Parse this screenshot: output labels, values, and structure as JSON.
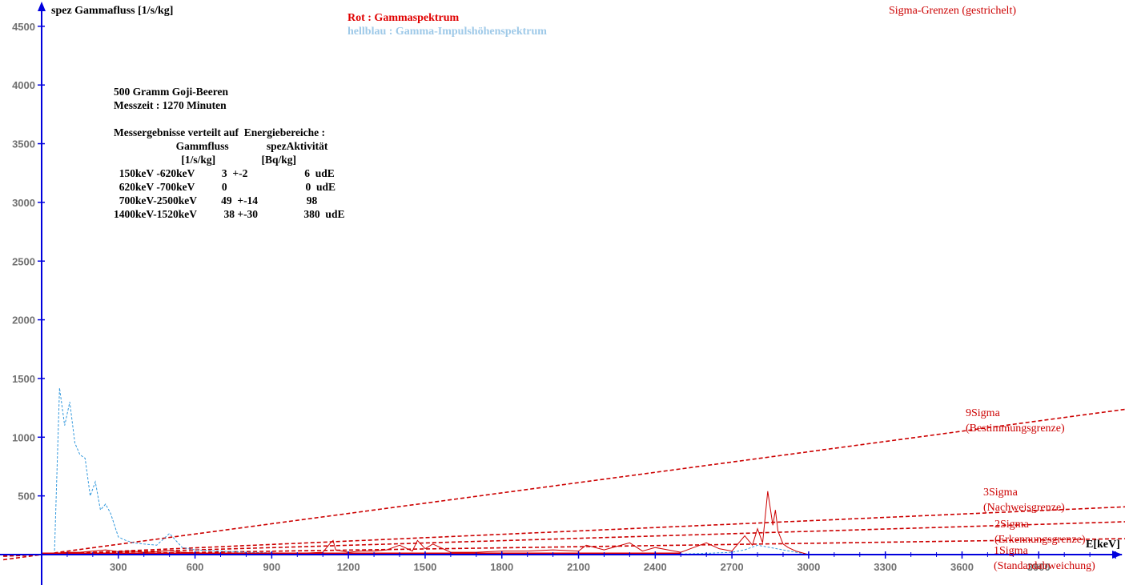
{
  "chart_data": {
    "type": "line",
    "ylabel": "spez Gammafluss [1/s/kg]",
    "xlabel": "E[keV]",
    "xlim": [
      -150,
      3900
    ],
    "ylim": [
      -40,
      4700
    ],
    "x_ticks": [
      300,
      600,
      900,
      1200,
      1500,
      1800,
      2100,
      2400,
      2700,
      3000,
      3300,
      3600,
      3900
    ],
    "y_ticks": [
      500,
      1000,
      1500,
      2000,
      2500,
      3000,
      3500,
      4000,
      4500
    ],
    "grid": false,
    "legend": {
      "red_label": "Rot   : Gammaspektrum",
      "blue_label": "hellblau : Gamma-Impulshöhenspektrum",
      "sigma_label": "Sigma-Grenzen (gestrichelt)"
    },
    "colors": {
      "red": "#cc0000",
      "blue": "#3399dd",
      "axis": "#0000dd"
    },
    "info_lines": [
      "500 Gramm Goji-Beeren",
      "Messzeit : 1270 Minuten",
      "",
      "Messergebnisse verteilt auf  Energiebereiche :",
      "                       Gammfluss              spezAktivität",
      "                         [1/s/kg]                 [Bq/kg]",
      "  150keV -620keV          3  +-2                     6  udE",
      "  620keV -700keV          0                             0  udE",
      "  700keV-2500keV         49  +-14                  98",
      "1400keV-1520keV          38 +-30                 380  udE"
    ],
    "sigma_lines": [
      {
        "label1": "9Sigma",
        "label2": "(Bestimmungsgrenze)",
        "slope": 0.292
      },
      {
        "label1": "3Sigma",
        "label2": "(Nachweisgrenze)",
        "slope": 0.096
      },
      {
        "label1": "2Sigma",
        "label2": "(Erkennungsgrenze)",
        "slope": 0.066
      },
      {
        "label1": "1Sigma",
        "label2": "(Standardabweichung)",
        "slope": 0.032
      }
    ],
    "series": [
      {
        "x": [
          50,
          70,
          90,
          110,
          130,
          150,
          170,
          190,
          210,
          230,
          250,
          270,
          300,
          330,
          360,
          400,
          450,
          500,
          550,
          600,
          700,
          800,
          900,
          1000,
          1100,
          1200,
          1300,
          1400,
          1500,
          1600,
          1700,
          1800,
          1900,
          2000,
          2100,
          2200,
          2300,
          2400,
          2500,
          2600,
          2700,
          2750,
          2800,
          2850,
          2900,
          2950,
          3000
        ],
        "values": [
          0,
          1420,
          1100,
          1300,
          950,
          850,
          820,
          500,
          620,
          380,
          430,
          350,
          150,
          120,
          100,
          90,
          80,
          180,
          60,
          40,
          30,
          20,
          15,
          10,
          10,
          10,
          8,
          8,
          8,
          6,
          6,
          5,
          5,
          5,
          5,
          5,
          5,
          5,
          5,
          10,
          20,
          40,
          80,
          60,
          40,
          20,
          0
        ]
      },
      {
        "x": [
          0,
          50,
          100,
          150,
          200,
          250,
          300,
          350,
          400,
          450,
          500,
          550,
          600,
          700,
          800,
          900,
          1000,
          1100,
          1130,
          1140,
          1150,
          1200,
          1250,
          1300,
          1350,
          1400,
          1450,
          1470,
          1500,
          1530,
          1600,
          1700,
          1800,
          1900,
          2000,
          2100,
          2130,
          2200,
          2300,
          2350,
          2400,
          2450,
          2500,
          2550,
          2600,
          2650,
          2700,
          2750,
          2780,
          2800,
          2820,
          2840,
          2860,
          2870,
          2880,
          2900,
          2920,
          2950,
          3000
        ],
        "values": [
          0,
          10,
          20,
          20,
          30,
          40,
          25,
          30,
          20,
          25,
          35,
          20,
          15,
          10,
          10,
          10,
          10,
          20,
          100,
          120,
          40,
          20,
          30,
          30,
          40,
          80,
          30,
          120,
          50,
          90,
          20,
          20,
          30,
          30,
          40,
          30,
          80,
          40,
          100,
          30,
          60,
          40,
          20,
          60,
          100,
          50,
          30,
          160,
          80,
          220,
          100,
          540,
          250,
          380,
          200,
          90,
          60,
          30,
          0
        ]
      }
    ]
  }
}
